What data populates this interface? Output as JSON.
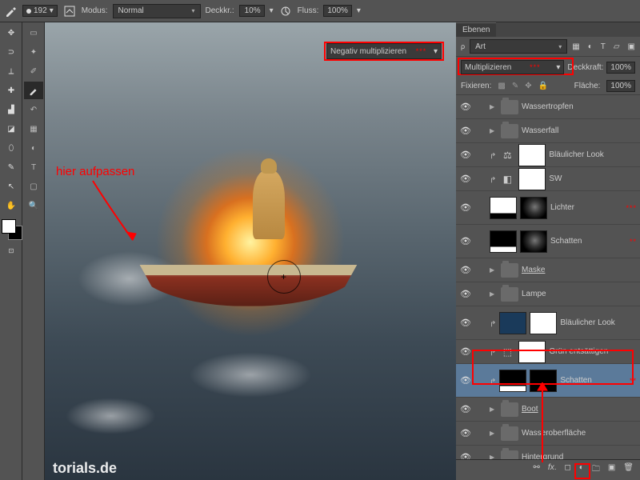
{
  "toolbar": {
    "brush_size": "192",
    "mode_label": "Modus:",
    "mode_value": "Normal",
    "opacity_label": "Deckkr.:",
    "opacity_value": "10%",
    "flow_label": "Fluss:",
    "flow_value": "100%"
  },
  "canvas": {
    "annotation_text": "hier aufpassen",
    "overlay_dropdown": "Negativ multiplizieren",
    "overlay_stars": "***",
    "watermark": "torials.de"
  },
  "panel": {
    "tab": "Ebenen",
    "kind_label": "Art",
    "blend_value": "Multiplizieren",
    "blend_stars": "***",
    "opacity_label": "Deckkraft:",
    "opacity_value": "100%",
    "lock_label": "Fixieren:",
    "fill_label": "Fläche:",
    "fill_value": "100%"
  },
  "layers": [
    {
      "type": "group",
      "name": "Wassertropfen"
    },
    {
      "type": "group",
      "name": "Wasserfall"
    },
    {
      "type": "adj",
      "name": "Bläulicher Look",
      "icon": "⚖",
      "clip": true,
      "mask": "white"
    },
    {
      "type": "adj",
      "name": "SW",
      "icon": "◧",
      "clip": true,
      "mask": "white"
    },
    {
      "type": "curves",
      "name": "Lichter",
      "stars": "***",
      "thumb": "grad",
      "mask": "mask"
    },
    {
      "type": "curves",
      "name": "Schatten",
      "stars": "**",
      "thumb": "grad-d",
      "mask": "mask"
    },
    {
      "type": "group",
      "name": "Maske",
      "underline": true
    },
    {
      "type": "group",
      "name": "Lampe"
    },
    {
      "type": "adj",
      "name": "Bläulicher Look",
      "icon": "",
      "clip": true,
      "thumb": "blue",
      "mask": "white"
    },
    {
      "type": "adj",
      "name": "Grün entsättigen",
      "icon": "⬚",
      "clip": true,
      "mask": "white"
    },
    {
      "type": "curves",
      "name": "Schatten",
      "stars": "**",
      "thumb": "grad-d",
      "mask": "dark",
      "clip": true,
      "selected": true
    },
    {
      "type": "group",
      "name": "Boot",
      "underline": true
    },
    {
      "type": "group",
      "name": "Wasseroberfläche"
    },
    {
      "type": "group",
      "name": "Hintergrund"
    }
  ],
  "colors": {
    "red": "#ff0000"
  }
}
